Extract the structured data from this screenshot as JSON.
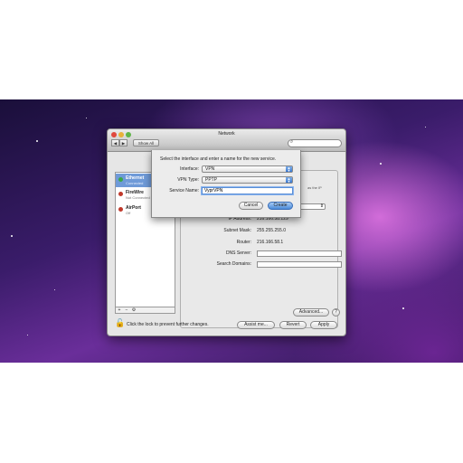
{
  "window": {
    "title": "Network",
    "show_all_label": "Show All",
    "back_label": "◀",
    "forward_label": "▶"
  },
  "services": [
    {
      "name": "Ethernet",
      "status": "Connected",
      "color": "#3aa845"
    },
    {
      "name": "FireWire",
      "status": "Not Connected",
      "color": "#c0392b"
    },
    {
      "name": "AirPort",
      "status": "Off",
      "color": "#c0392b"
    }
  ],
  "sidebar_footer": {
    "add": "+",
    "remove": "−",
    "gear": "⚙"
  },
  "panel": {
    "obscured_text": "as the IP",
    "ip_label": "IP Address:",
    "ip_value": "216.166.58.129",
    "subnet_label": "Subnet Mask:",
    "subnet_value": "255.255.255.0",
    "router_label": "Router:",
    "router_value": "216.166.58.1",
    "dns_label": "DNS Server:",
    "dns_value": "",
    "search_label": "Search Domains:",
    "search_value": "",
    "advanced_label": "Advanced...",
    "help_label": "?"
  },
  "footer": {
    "lock_text": "Click the lock to prevent further changes.",
    "assist_label": "Assist me...",
    "revert_label": "Revert",
    "apply_label": "Apply"
  },
  "sheet": {
    "prompt": "Select the interface and enter a name for the new service.",
    "interface_label": "Interface:",
    "interface_value": "VPN",
    "vpn_type_label": "VPN Type:",
    "vpn_type_value": "PPTP",
    "service_name_label": "Service Name:",
    "service_name_value": "VyprVPN",
    "cancel_label": "Cancel",
    "create_label": "Create"
  },
  "colors": {
    "accent": "#3a78cf",
    "selection": "#6f9ad8"
  }
}
